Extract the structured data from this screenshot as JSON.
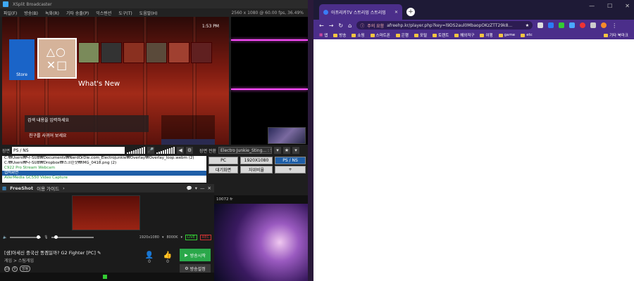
{
  "broadcaster": {
    "title": "XSplit Broadcaster",
    "menu": [
      "파일(F)",
      "방송(B)",
      "녹화(R)",
      "기타 송출(P)",
      "익스텐션",
      "도구(T)",
      "도움말(H)"
    ],
    "resolution": "2560 x 1080 @ 60.00 fps, 36.49%",
    "ps4": {
      "store_label": "Store",
      "whats_new": "What's New",
      "clock": "1:53 PM",
      "friend_text": "친구를 사귀어 보세요",
      "search_hint": "검색 내용을 입력하세요"
    },
    "audio_label": "장면",
    "scene_name_input": "PS / NS",
    "transition_label": "장면 전환",
    "transition_value": "Electro Junkie_Sting... : 500ms",
    "sources": [
      {
        "text": "C:₩Users₩다-SUB₩Documents₩NerdOrDie.com_Electrojunkie₩Overlay₩Overlay_loop.webm (2)",
        "style": ""
      },
      {
        "text": "C:₩Users₩다-SUB₩Dropbox₩스크린샷₩IMG_0418.png (2)",
        "style": ""
      },
      {
        "text": "C922 Pro Stream Webcam",
        "style": "green"
      },
      {
        "text": "캡처화면",
        "style": "sel"
      },
      {
        "text": "AVerMedia GC550 Video Capture",
        "style": "green"
      }
    ],
    "scenes": [
      "PC",
      "1920X1080",
      "PS / NS",
      "대기화면",
      "자위비율",
      "+"
    ],
    "active_scene": "PS / NS",
    "status_text": "10072 fr"
  },
  "freeshot": {
    "title": "FreeShot",
    "guide": "이용 가이드",
    "resolution": "1920x1080",
    "bitrate": "8000K",
    "tag_live": "LIVE",
    "tag_rec": "REC",
    "broadcast_title": "[샘]아세신 중국산 똥겜일까? G2 Fighter [PC]",
    "category": "게임 > 스팀게임",
    "badge": "방펑",
    "viewers": "0",
    "likes": "0",
    "start_button": "방송시작",
    "settings_button": "방송설정"
  },
  "browser": {
    "tab_title": "아프리카TV 스트리밍 스트리밍",
    "url_warning": "주의 요함",
    "url": "afreehp.kr/player.php?key=l9DS2aul0MbaopOKzZTT29k8...",
    "bookmarks": [
      "앱",
      "방송",
      "쇼핑",
      "스마트폰",
      "은행",
      "포털",
      "토렌트",
      "해외직구",
      "여행",
      "game",
      "etc"
    ],
    "other_bookmarks": "기타 북마크"
  },
  "colors": {
    "accent_purple": "#4b2e8a",
    "live_green": "#2aa84a",
    "selection_blue": "#1f5fa8"
  }
}
